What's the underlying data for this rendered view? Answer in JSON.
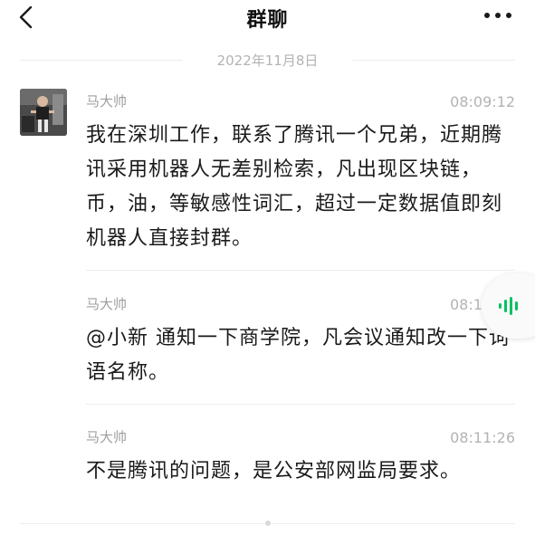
{
  "header": {
    "title": "群聊",
    "back_icon": "chevron-left-icon",
    "more_icon": "more-dots-icon"
  },
  "date_divider": "2022年11月8日",
  "messages": [
    {
      "sender": "马大帅",
      "time": "08:09:12",
      "text": "我在深圳工作，联系了腾讯一个兄弟，近期腾讯采用机器人无差别检索，凡出现区块链，币，油，等敏感性词汇，超过一定数据值即刻机器人直接封群。"
    },
    {
      "sender": "马大帅",
      "time": "08:10",
      "time_visible": "08:1",
      "text": "@小新 通知一下商学院，凡会议通知改一下词语名称。"
    },
    {
      "sender": "马大帅",
      "time": "08:11:26",
      "text": "不是腾讯的问题，是公安部网监局要求。"
    }
  ],
  "floating_widget": {
    "icon": "voice-wave-icon",
    "accent_color": "#07c160"
  },
  "colors": {
    "accent": "#07c160",
    "text": "#1a1a1a",
    "meta": "#b3b3b3"
  }
}
